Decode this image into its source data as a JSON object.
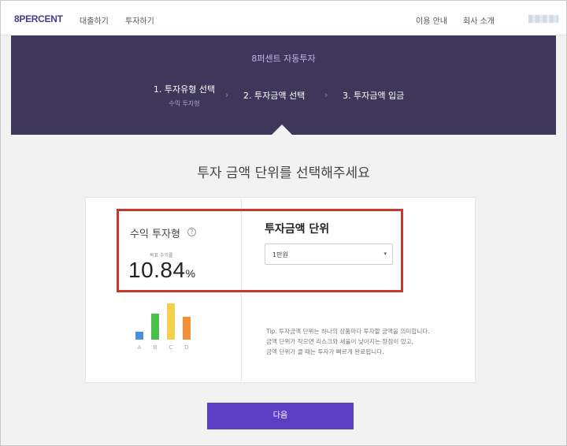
{
  "nav": {
    "logo": "8PERCENT",
    "loan": "대출하기",
    "invest": "투자하기",
    "guide": "이용 안내",
    "company": "회사 소개"
  },
  "hero": {
    "title": "8퍼센트 자동투자",
    "steps": [
      {
        "label": "1. 투자유형 선택",
        "sub": "수익 투자형"
      },
      {
        "label": "2. 투자금액 선택"
      },
      {
        "label": "3. 투자금액 입금"
      }
    ],
    "separator": "›"
  },
  "question": "투자 금액 단위를 선택해주세요",
  "left_panel": {
    "type_label": "수익 투자형",
    "help_icon": "?",
    "rate_caption": "목표 수익률",
    "rate_value": "10.84",
    "rate_unit": "%",
    "grades": [
      {
        "label": "A",
        "level": 0.22,
        "color": "#4a90e2"
      },
      {
        "label": "B",
        "level": 0.72,
        "color": "#4bbf4b"
      },
      {
        "label": "C",
        "level": 1.0,
        "color": "#f5d04a"
      },
      {
        "label": "D",
        "level": 0.62,
        "color": "#f0913a"
      }
    ]
  },
  "right_panel": {
    "title": "투자금액 단위",
    "select_value": "1만원",
    "select_caret": "▾",
    "tip_lines": [
      "Tip. 투자금액 단위는 하나의 상품마다 투자할 금액을 의미합니다.",
      "금액 단위가 작으면 리스크와 세율이 낮아지는 장점이 있고,",
      "금액 단위가 클 때는 투자가 빠르게 완료됩니다."
    ]
  },
  "next_label": "다음",
  "colors": {
    "accent": "#5c3fc4",
    "hero_bg": "#3e3759",
    "highlight": "#c8372d"
  }
}
